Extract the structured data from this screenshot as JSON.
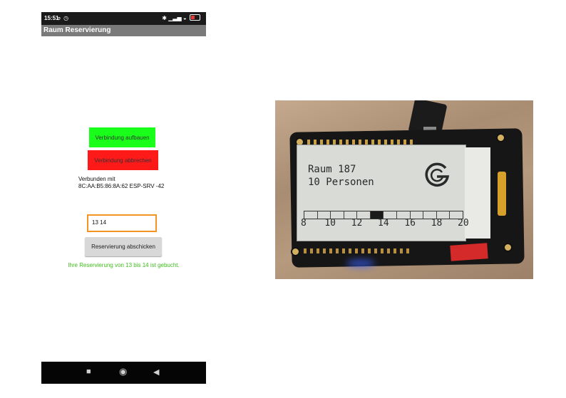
{
  "phone": {
    "status_bar": {
      "time": "15:51",
      "left_icons": [
        "alarm-off-icon",
        "clock-icon"
      ],
      "right_icons": [
        "bluetooth-icon",
        "signal-icon",
        "wifi-icon",
        "battery-icon"
      ]
    },
    "app_title": "Raum Reservierung",
    "connect_button": "Verbindung aufbauen",
    "disconnect_button": "Verbindung abbrechen",
    "connection_status_line1": "Verbunden mit",
    "connection_status_line2": "8C:AA:B5:86:8A:62 ESP-SRV -42",
    "time_input_value": "13 14",
    "submit_button": "Reservierung abschicken",
    "confirmation": "Ihre Reservierung von 13 bis 14 ist gebucht.",
    "nav": {
      "recents_icon": "square-icon",
      "home_icon": "circle-icon",
      "back_icon": "triangle-back-icon"
    },
    "colors": {
      "connect": "#19ff19",
      "disconnect": "#ff1a1a",
      "input_border": "#f39425",
      "confirmation_text": "#3fbf1c"
    }
  },
  "photo": {
    "display_line1": "Raum 187",
    "display_line2": "10 Personen",
    "ticks": [
      "8",
      "10",
      "12",
      "14",
      "16",
      "18",
      "20"
    ],
    "booked_slots": [
      13
    ]
  }
}
